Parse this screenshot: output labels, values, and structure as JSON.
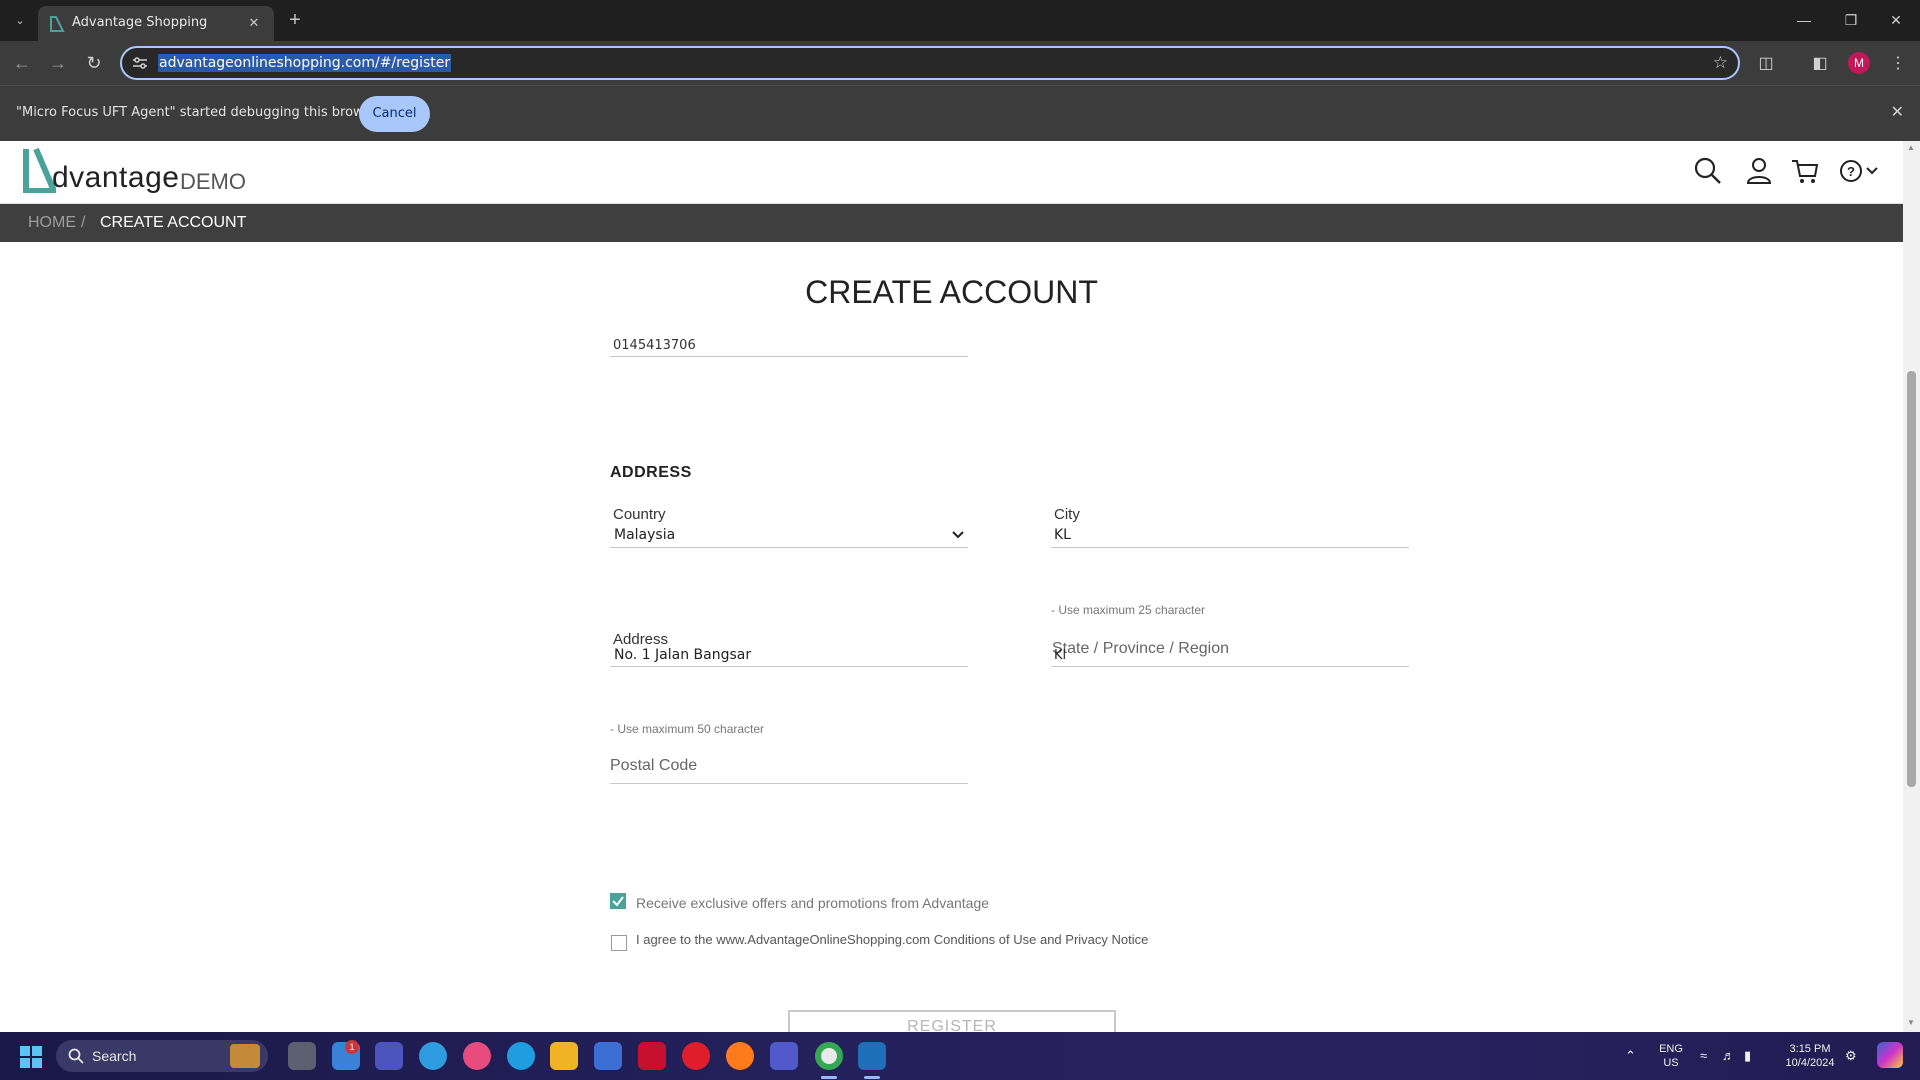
{
  "browser": {
    "tab_title": "Advantage Shopping",
    "url": "advantageonlineshopping.com/#/register",
    "profile_initial": "M"
  },
  "infobar": {
    "message": "\"Micro Focus UFT Agent\" started debugging this browser",
    "cancel_label": "Cancel"
  },
  "site": {
    "logo_text": "dvantage",
    "logo_demo": "DEMO",
    "accent_color": "#4aa39a"
  },
  "breadcrumb": {
    "home": "HOME",
    "separator": "/",
    "current": "CREATE ACCOUNT"
  },
  "form": {
    "title": "CREATE ACCOUNT",
    "phone_value": "0145413706",
    "address_section": "ADDRESS",
    "country": {
      "label": "Country",
      "value": "Malaysia"
    },
    "city": {
      "label": "City",
      "value": "KL",
      "hint": "- Use maximum 25 character"
    },
    "address": {
      "label": "Address",
      "value": "No. 1 Jalan Bangsar",
      "hint": "- Use maximum 50 character"
    },
    "state": {
      "placeholder": "State / Province / Region",
      "value": "Kl"
    },
    "postal": {
      "placeholder": "Postal Code"
    },
    "offers": {
      "label": "Receive exclusive offers and promotions from Advantage",
      "checked": true
    },
    "agree": {
      "label": "I agree to the www.AdvantageOnlineShopping.com Conditions of Use and Privacy Notice",
      "checked": false
    },
    "register_label": "REGISTER"
  },
  "taskbar": {
    "search_label": "Search",
    "language": "ENG",
    "region": "US",
    "time": "3:15 PM",
    "date": "10/4/2024",
    "notification_count": "1"
  }
}
